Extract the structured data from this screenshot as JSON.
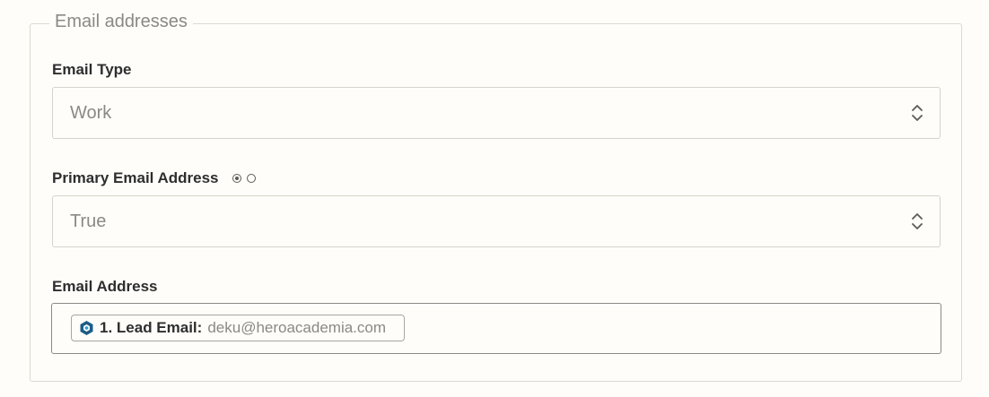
{
  "section": {
    "legend": "Email addresses"
  },
  "email_type": {
    "label": "Email Type",
    "value": "Work"
  },
  "primary_email": {
    "label": "Primary Email Address",
    "value": "True"
  },
  "email_address": {
    "label": "Email Address",
    "pill_label": "1. Lead Email:",
    "pill_value": "deku@heroacademia.com"
  },
  "icons": {
    "select_chevron": "chevron-up-down-icon",
    "app_logo": "app-logo-icon",
    "radio_selected": "radio-selected-icon",
    "radio_unselected": "radio-unselected-icon"
  },
  "colors": {
    "background": "#fffdf9",
    "border": "#d6d3cd",
    "label": "#2d2e2e",
    "muted": "#8c8985",
    "logo_blue": "#1c5e86"
  }
}
